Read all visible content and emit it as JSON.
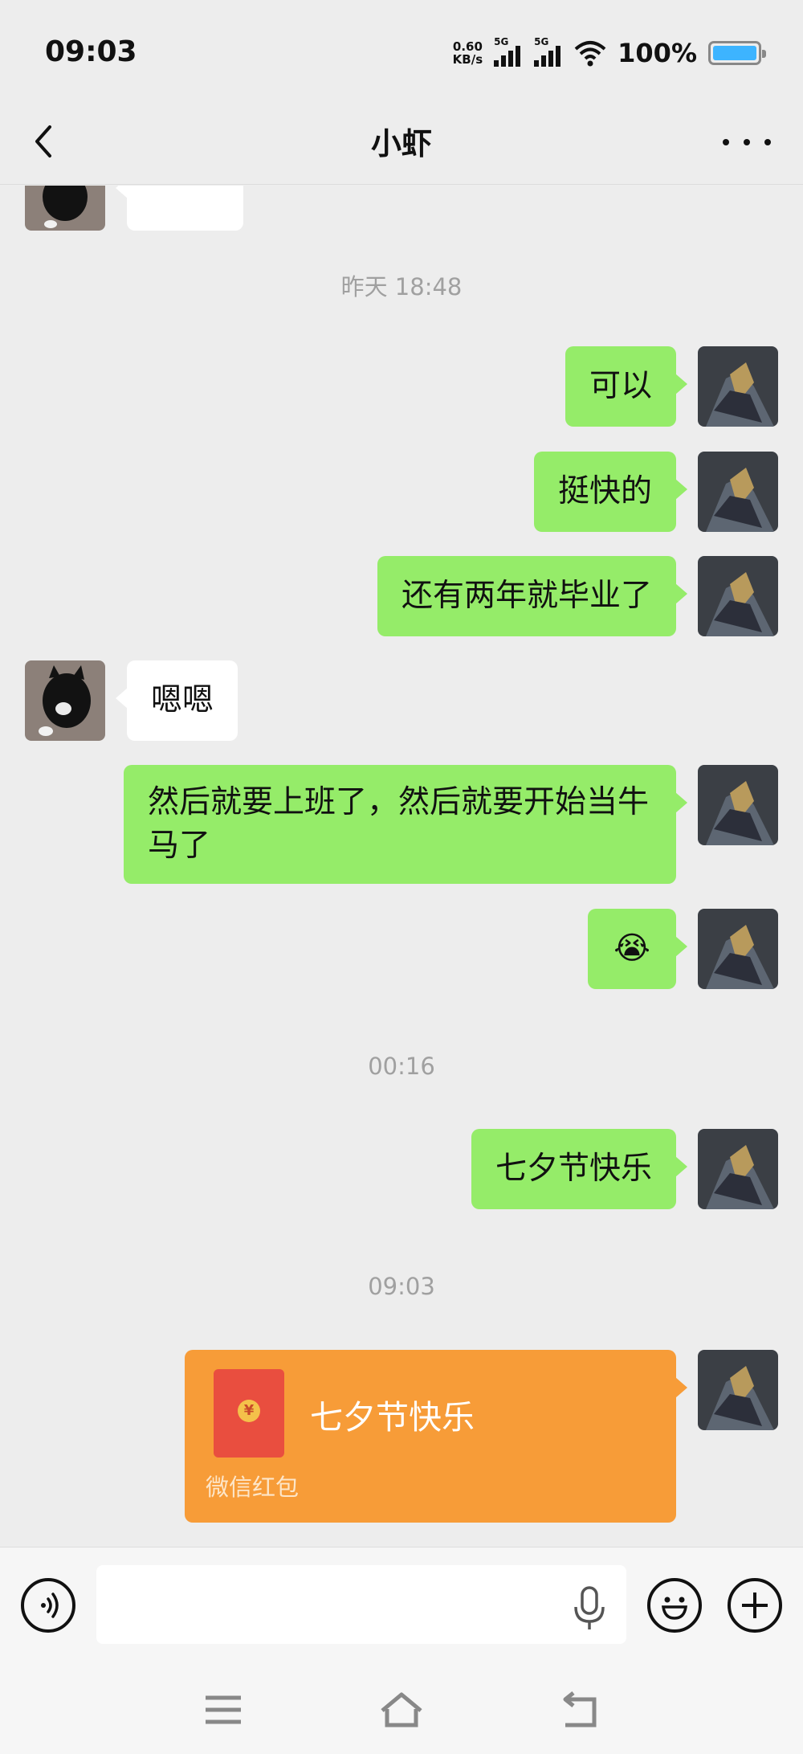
{
  "status_bar": {
    "time": "09:03",
    "net_speed_value": "0.60",
    "net_speed_unit": "KB/s",
    "signal1_label": "5G",
    "signal2_label": "5G",
    "battery_percent": "100%"
  },
  "header": {
    "title": "小虾"
  },
  "chat": {
    "timestamps": [
      "昨天 18:48",
      "00:16",
      "09:03"
    ],
    "messages": [
      {
        "side": "out",
        "text": "可以"
      },
      {
        "side": "out",
        "text": "挺快的"
      },
      {
        "side": "out",
        "text": "还有两年就毕业了"
      },
      {
        "side": "in",
        "text": "嗯嗯"
      },
      {
        "side": "out",
        "text": "然后就要上班了，然后就要开始当牛马了"
      },
      {
        "side": "out",
        "text": "😭"
      },
      {
        "side": "out",
        "text": "七夕节快乐"
      }
    ],
    "red_packet": {
      "title": "七夕节快乐",
      "label": "微信红包",
      "coin_symbol": "¥"
    }
  },
  "input_bar": {
    "placeholder": ""
  },
  "colors": {
    "outgoing_bubble": "#95ec69",
    "incoming_bubble": "#ffffff",
    "red_packet": "#f79c38",
    "background": "#ededed"
  },
  "icons": [
    "back-icon",
    "more-icon",
    "voice-icon",
    "mic-icon",
    "emoji-icon",
    "plus-icon",
    "menu-icon",
    "home-icon",
    "return-icon"
  ]
}
